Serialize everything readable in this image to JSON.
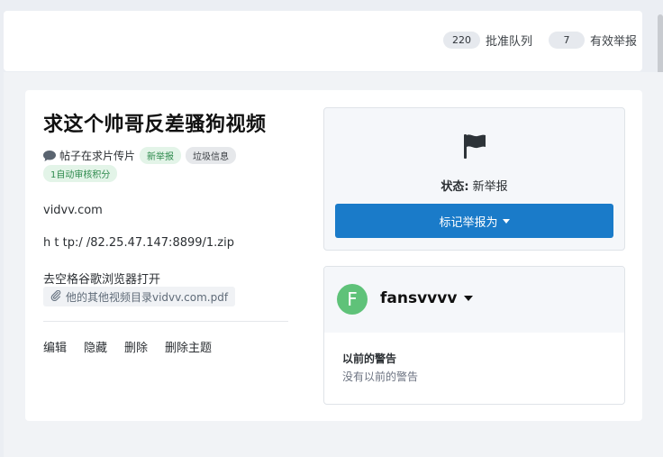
{
  "stats": [
    {
      "count": "220",
      "label": "批准队列"
    },
    {
      "count": "7",
      "label": "有效举报"
    }
  ],
  "post": {
    "title": "求这个帅哥反差骚狗视频",
    "forum": "帖子在求片传片",
    "tags": [
      "新举报",
      "垃圾信息"
    ],
    "auto_tag": "1自动审核积分",
    "lines": [
      "vidvv.com",
      "h t tp:/ /82.25.47.147:8899/1.zip",
      "去空格谷歌浏览器打开"
    ],
    "attachment": "他的其他视频目录vidvv.com.pdf",
    "actions": [
      "编辑",
      "隐藏",
      "删除",
      "删除主题"
    ]
  },
  "status": {
    "label": "状态:",
    "value": "新举报",
    "button": "标记举报为"
  },
  "user": {
    "initial": "F",
    "name": "fansvvvv",
    "warn_title": "以前的警告",
    "warn_text": "没有以前的警告"
  },
  "colors": {
    "accent": "#1a7bc9",
    "avatar": "#5fc279",
    "tag_green_bg": "#e3f4e8",
    "tag_green_fg": "#2f8b4e"
  },
  "icons": [
    "comment-icon",
    "flag-icon",
    "paperclip-icon",
    "chevron-down-icon"
  ]
}
